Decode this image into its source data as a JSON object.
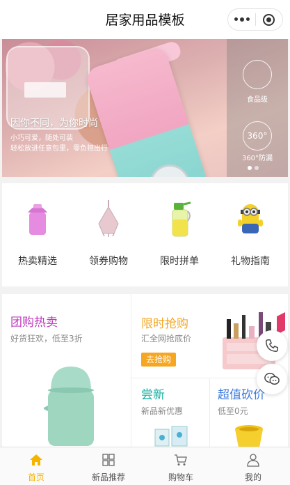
{
  "header": {
    "title": "居家用品模板"
  },
  "banner": {
    "slogan": "因你不同，为你时尚",
    "sub1": "小巧可爱，随处可装",
    "sub2": "轻松放进任意包里，零负担出行",
    "side_label_1": "食品级",
    "side_label_2": "360°防漏",
    "side_badge": "360°",
    "slides": 2,
    "current_slide": 1
  },
  "categories": [
    {
      "label": "热卖精选",
      "icon": "trash-bin-icon"
    },
    {
      "label": "领券购物",
      "icon": "towel-icon"
    },
    {
      "label": "限时拼单",
      "icon": "oil-bottle-icon"
    },
    {
      "label": "礼物指南",
      "icon": "minion-toy-icon"
    }
  ],
  "promo": {
    "group": {
      "title": "团购热卖",
      "subtitle": "好货狂欢，低至3折"
    },
    "flash": {
      "title": "限时抢购",
      "subtitle": "汇全网抢底价",
      "button": "去抢购"
    },
    "new": {
      "title": "尝新",
      "subtitle": "新品新优惠"
    },
    "bargain": {
      "title": "超值砍价",
      "subtitle": "低至0元"
    }
  },
  "tabs": [
    {
      "label": "首页",
      "icon": "home-icon",
      "active": true
    },
    {
      "label": "新品推荐",
      "icon": "grid-icon",
      "active": false
    },
    {
      "label": "购物车",
      "icon": "cart-icon",
      "active": false
    },
    {
      "label": "我的",
      "icon": "user-icon",
      "active": false
    }
  ],
  "colors": {
    "group_title": "#c03cc0",
    "flash_title": "#f5a623",
    "new_title": "#1ab1a3",
    "bargain_title": "#3f7be0",
    "accent": "#f5b400"
  }
}
